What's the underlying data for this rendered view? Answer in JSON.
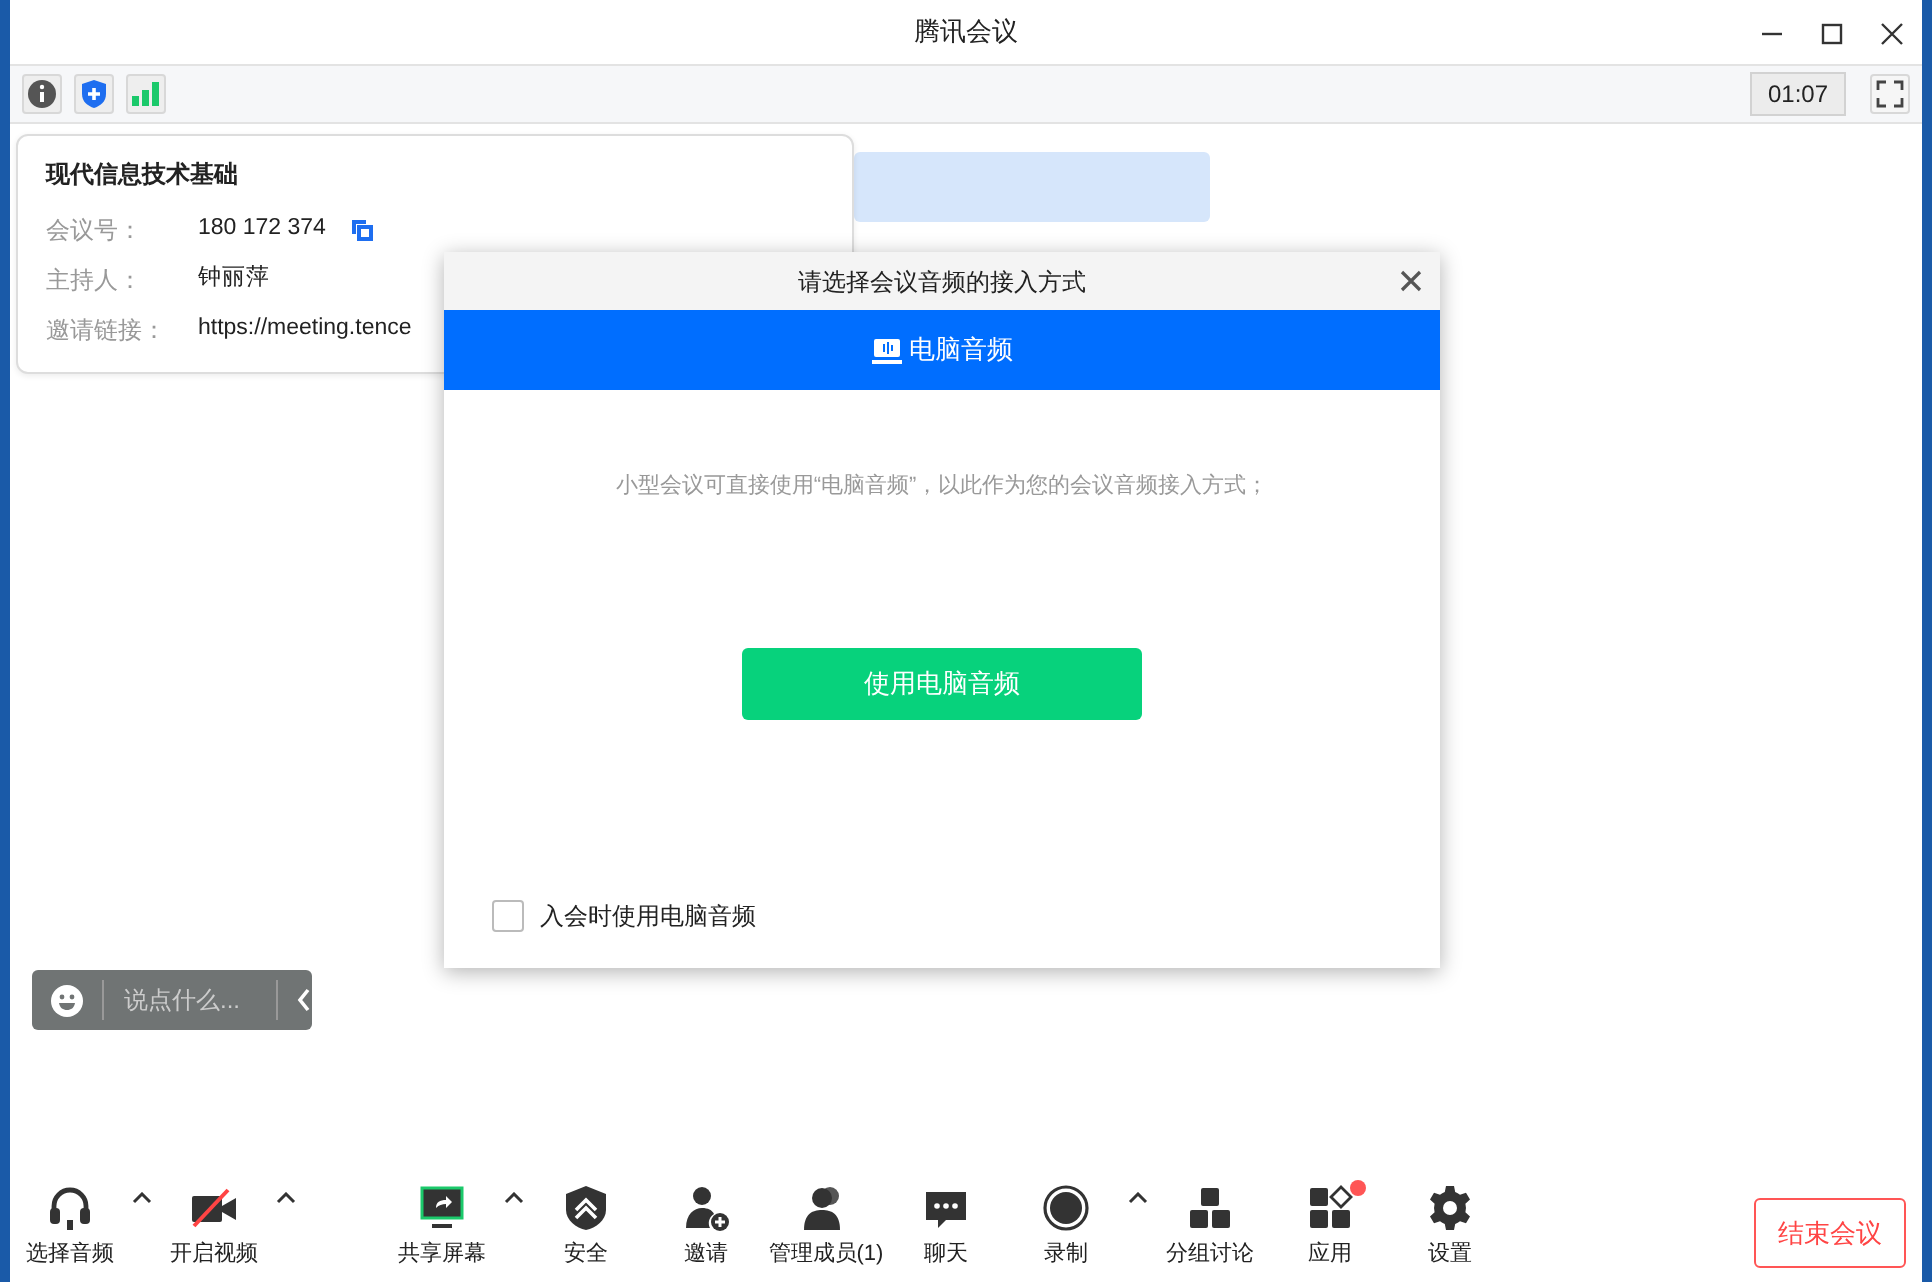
{
  "window": {
    "title": "腾讯会议"
  },
  "top_bar": {
    "timer": "01:07"
  },
  "meeting_info": {
    "title": "现代信息技术基础",
    "fields": [
      {
        "label": "会议号：",
        "value": "180 172 374",
        "copyable": true
      },
      {
        "label": "主持人：",
        "value": "钟丽萍",
        "copyable": false
      },
      {
        "label": "邀请链接：",
        "value": "https://meeting.tence",
        "copyable": false
      }
    ]
  },
  "dialog": {
    "title": "请选择会议音频的接入方式",
    "tabs": [
      {
        "label": "电脑音频",
        "selected": true
      }
    ],
    "description": "小型会议可直接使用“电脑音频”，以此作为您的会议音频接入方式；",
    "primary_button": "使用电脑音频",
    "checkbox": {
      "label": "入会时使用电脑音频",
      "checked": false
    }
  },
  "chat_input": {
    "placeholder": "说点什么..."
  },
  "toolbar": {
    "items": [
      {
        "label": "选择音频",
        "has_menu": true,
        "notification": false
      },
      {
        "label": "开启视频",
        "has_menu": true,
        "notification": false
      },
      {
        "label": "共享屏幕",
        "has_menu": true,
        "notification": false
      },
      {
        "label": "安全",
        "has_menu": false,
        "notification": false
      },
      {
        "label": "邀请",
        "has_menu": false,
        "notification": false
      },
      {
        "label": "管理成员(1)",
        "has_menu": false,
        "notification": false
      },
      {
        "label": "聊天",
        "has_menu": false,
        "notification": false
      },
      {
        "label": "录制",
        "has_menu": true,
        "notification": false
      },
      {
        "label": "分组讨论",
        "has_menu": false,
        "notification": false
      },
      {
        "label": "应用",
        "has_menu": false,
        "notification": true
      },
      {
        "label": "设置",
        "has_menu": false,
        "notification": false
      }
    ],
    "end_button": "结束会议"
  }
}
